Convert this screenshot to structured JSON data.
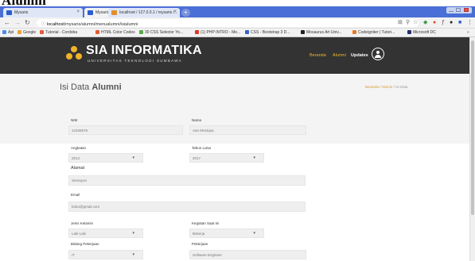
{
  "caption": "Alumni",
  "browser": {
    "tabs": [
      {
        "label": "Mysaris",
        "active": false
      },
      {
        "label": "Mysaris",
        "active": true
      },
      {
        "label": "localhost / 127.0.0.1 / mysaris /...",
        "active": false
      }
    ],
    "address_host": "localhost",
    "address_path": "/mysaris/alumni/menualumni/isialumni",
    "bookmarks": [
      {
        "label": "Apl",
        "color": "#4a8cf0"
      },
      {
        "label": "Google",
        "color": "#eaa23a"
      },
      {
        "label": "Tutorial - Cordoba",
        "color": "#e25b3a"
      },
      {
        "label": "HTML Color Codes",
        "color": "#e55b2f"
      },
      {
        "label": "30 CSS Selector Yo...",
        "color": "#58a84a"
      },
      {
        "label": "(1) PHP INTRO - Me...",
        "color": "#e0362a"
      },
      {
        "label": "CSS - Bootstrap 3 D...",
        "color": "#3a5fc8"
      },
      {
        "label": "Mosaurus Art Univ...",
        "color": "#222222"
      },
      {
        "label": "Codeigniter | Tutori...",
        "color": "#e57b2b"
      },
      {
        "label": "Microsoft DC",
        "color": "#23306b"
      }
    ]
  },
  "site": {
    "brand_title": "SIA INFORMATIKA",
    "brand_sub": "UNIVERSITAS TEKNOLOGI SUMBAWA",
    "nav": {
      "beranda": "Beranda",
      "alumni": "Alumni",
      "updates": "Updates"
    },
    "page_title_prefix": "Isi Data ",
    "page_title_bold": "Alumni",
    "breadcrumb": {
      "home": "Beranda",
      "sep1": " / ",
      "section": "Alumni",
      "sep2": " / ",
      "current": "Isi Data"
    }
  },
  "form": {
    "nim": {
      "label": "NIM",
      "value": "12345678"
    },
    "nama": {
      "label": "Nama",
      "value": "Aan Mustopa"
    },
    "angkatan": {
      "label": "Angkatan",
      "value": "2013"
    },
    "tahun_lulus": {
      "label": "Tahun Lulus",
      "value": "2017"
    },
    "alamat_section": "Alamat",
    "alamat": {
      "value": "Semayon"
    },
    "email": {
      "label": "Email",
      "value": "bobo@gmail.com"
    },
    "jenis_kelamin": {
      "label": "Jenis Kelamin",
      "value": "Laki-Laki"
    },
    "kegiatan": {
      "label": "Kegiatan Saat Ini",
      "value": "Bekerja"
    },
    "bidang": {
      "label": "Bidang Pekerjaan",
      "value": "IT"
    },
    "pekerjaan": {
      "label": "Pekerjaan",
      "value": "Software Engineer"
    }
  }
}
